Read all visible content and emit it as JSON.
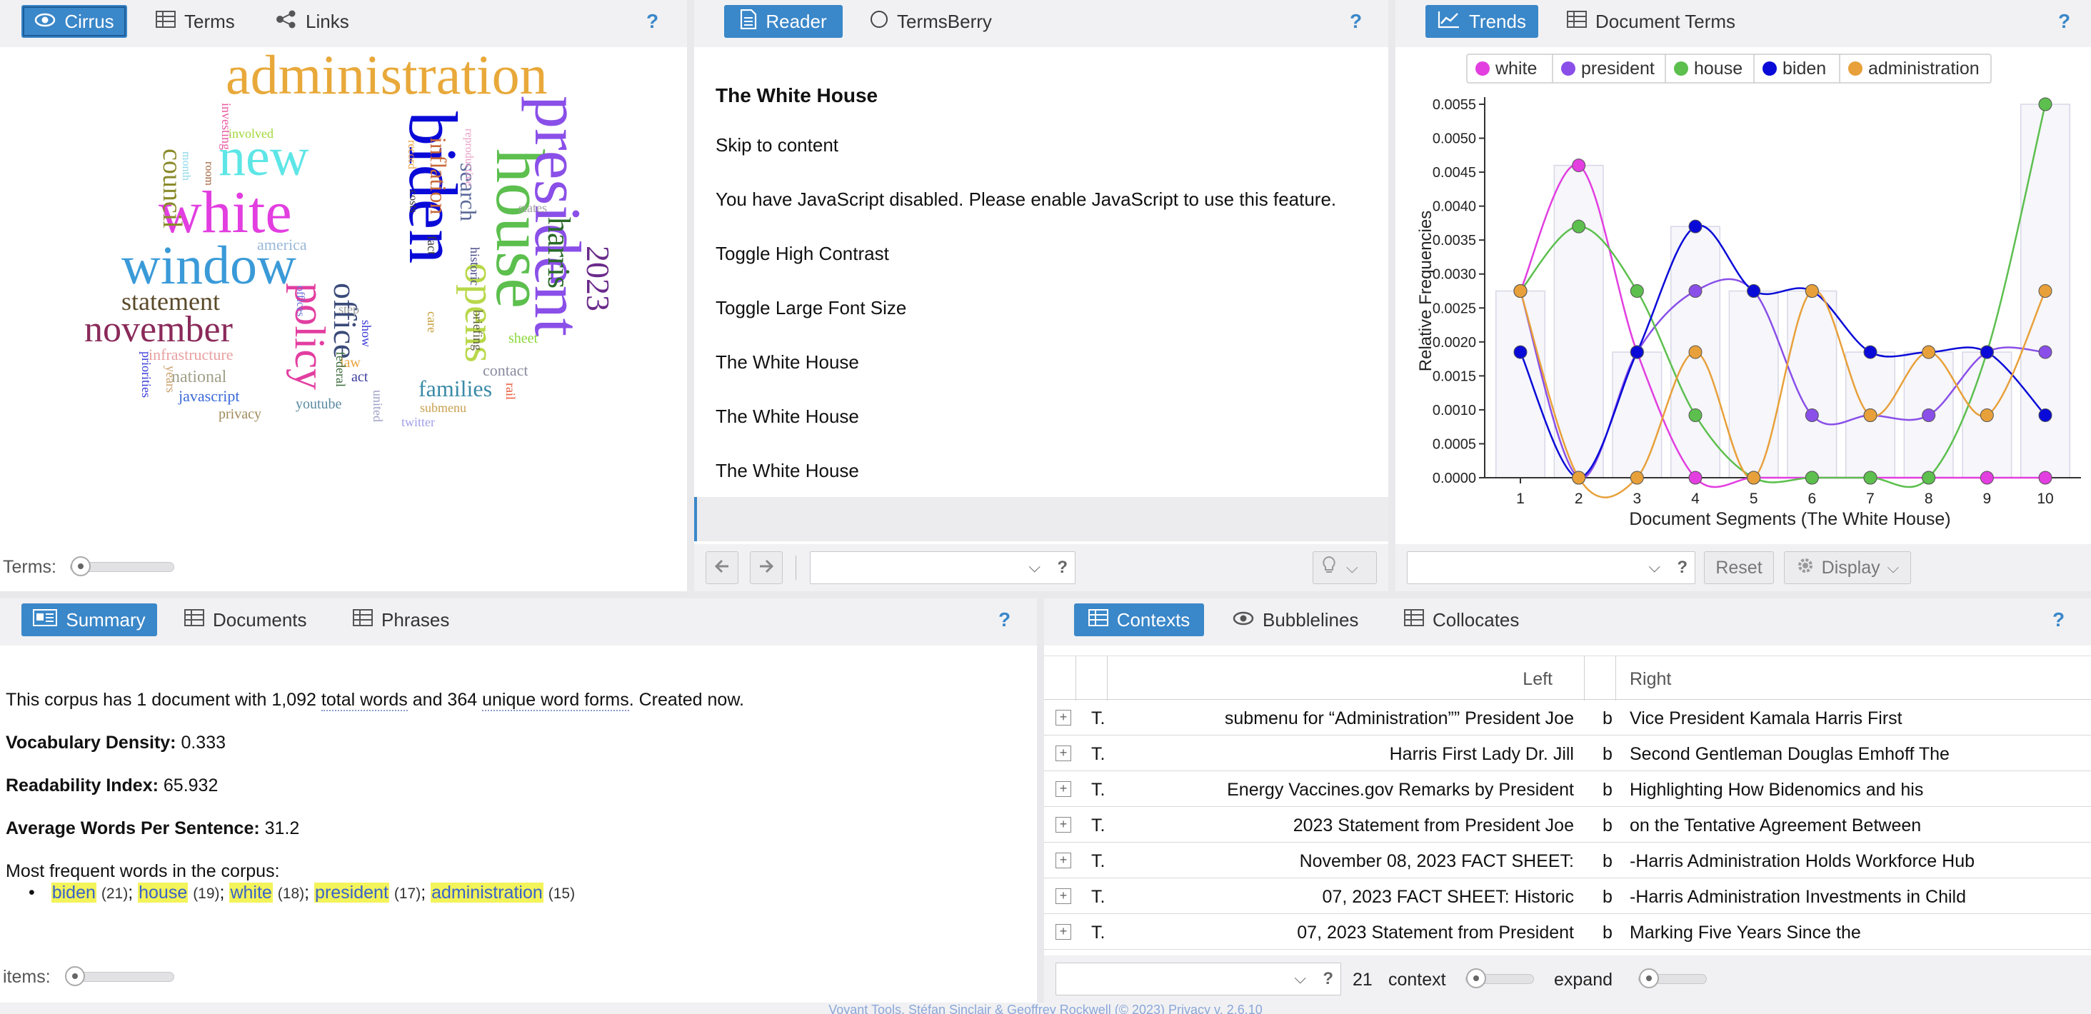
{
  "cirrus_panel": {
    "tabs": [
      {
        "label": "Cirrus",
        "icon": "eye-icon"
      },
      {
        "label": "Terms",
        "icon": "table-icon"
      },
      {
        "label": "Links",
        "icon": "network-icon"
      }
    ],
    "help": "?",
    "terms_label": "Terms:",
    "words": [
      {
        "text": "administration",
        "color": "#e8a93a"
      },
      {
        "text": "biden",
        "color": "#0a0ad8"
      },
      {
        "text": "house",
        "color": "#5cbf4e"
      },
      {
        "text": "president",
        "color": "#8a4fe8"
      },
      {
        "text": "white",
        "color": "#e23ee0"
      },
      {
        "text": "window",
        "color": "#3a9ad8"
      },
      {
        "text": "new",
        "color": "#5ee6e6"
      },
      {
        "text": "opens",
        "color": "#b8d84a"
      },
      {
        "text": "november",
        "color": "#8a2a5a"
      },
      {
        "text": "policy",
        "color": "#e23ea0"
      },
      {
        "text": "office",
        "color": "#3a4a7a"
      },
      {
        "text": "harris",
        "color": "#2a6a2a"
      },
      {
        "text": "2023",
        "color": "#6a2a8a"
      },
      {
        "text": "council",
        "color": "#8a8a2a"
      },
      {
        "text": "statement",
        "color": "#5a4a2a"
      },
      {
        "text": "families",
        "color": "#3a8aa8"
      },
      {
        "text": "search",
        "color": "#5a6a9a"
      },
      {
        "text": "inflation",
        "color": "#c86a3a"
      },
      {
        "text": "america",
        "color": "#9ab8d8"
      },
      {
        "text": "infrastructure",
        "color": "#e8a0a0"
      },
      {
        "text": "national",
        "color": "#a0a08a"
      },
      {
        "text": "javascript",
        "color": "#3a6ad8"
      },
      {
        "text": "privacy",
        "color": "#a08a5a"
      },
      {
        "text": "youtube",
        "color": "#5a8aa0"
      },
      {
        "text": "contact",
        "color": "#8a8aa0"
      },
      {
        "text": "twitter",
        "color": "#a0a0e8"
      },
      {
        "text": "submenu",
        "color": "#c8a050"
      },
      {
        "text": "rail",
        "color": "#e85a3a"
      },
      {
        "text": "act",
        "color": "#3a3aa0"
      },
      {
        "text": "law",
        "color": "#e8a03a"
      },
      {
        "text": "federal",
        "color": "#3a6a3a"
      },
      {
        "text": "united",
        "color": "#a0a0c8"
      },
      {
        "text": "show",
        "color": "#3a3ad8"
      },
      {
        "text": "step",
        "color": "#a0a0a0"
      },
      {
        "text": "care",
        "color": "#c8a03a"
      },
      {
        "text": "briefing",
        "color": "#5a5a3a"
      },
      {
        "text": "historic",
        "color": "#4a4a8a"
      },
      {
        "text": "sheet",
        "color": "#8ad83a"
      },
      {
        "text": "states",
        "color": "#a0a0a0"
      },
      {
        "text": "fact",
        "color": "#3a3a3a"
      },
      {
        "text": "costs",
        "color": "#3a3a3a"
      },
      {
        "text": "record",
        "color": "#e8a03a"
      },
      {
        "text": "reproductive",
        "color": "#e8a0c8"
      },
      {
        "text": "involved",
        "color": "#a0d83a"
      },
      {
        "text": "investing",
        "color": "#e85aa0"
      },
      {
        "text": "room",
        "color": "#a0603a"
      },
      {
        "text": "month",
        "color": "#8ad8e8"
      },
      {
        "text": "offices",
        "color": "#6a6ad8"
      },
      {
        "text": "priorities",
        "color": "#3a3ad8"
      },
      {
        "text": "years",
        "color": "#c8a06a"
      }
    ]
  },
  "reader_panel": {
    "tabs": [
      {
        "label": "Reader",
        "icon": "document-icon"
      },
      {
        "label": "TermsBerry",
        "icon": "circle-icon"
      }
    ],
    "help": "?",
    "heading": "The White House",
    "lines": [
      "Skip to content",
      "You have JavaScript disabled. Please enable JavaScript to use this feature.",
      "Toggle High Contrast",
      "Toggle Large Font Size",
      "The White House",
      "The White House",
      "The White House"
    ]
  },
  "trends_panel": {
    "tabs": [
      {
        "label": "Trends",
        "icon": "line-chart-icon"
      },
      {
        "label": "Document Terms",
        "icon": "table-icon"
      }
    ],
    "help": "?",
    "reset_label": "Reset",
    "display_label": "Display"
  },
  "chart_data": {
    "type": "line",
    "xlabel": "Document Segments (The White House)",
    "ylabel": "Relative Frequencies",
    "x": [
      1,
      2,
      3,
      4,
      5,
      6,
      7,
      8,
      9,
      10
    ],
    "ylim": [
      0,
      0.0055
    ],
    "yticks": [
      "0.0000",
      "0.0005",
      "0.0010",
      "0.0015",
      "0.0020",
      "0.0025",
      "0.0030",
      "0.0035",
      "0.0040",
      "0.0045",
      "0.0050",
      "0.0055"
    ],
    "legend_position": "top",
    "series": [
      {
        "name": "white",
        "color": "#e23ee0",
        "values": [
          0.00275,
          0.0046,
          0.00185,
          0.0,
          0.0,
          0.0,
          0.0,
          0.0,
          0.0,
          0.0
        ]
      },
      {
        "name": "president",
        "color": "#8a4fe8",
        "values": [
          0.00275,
          0.0,
          0.00185,
          0.00275,
          0.00275,
          0.00092,
          0.00092,
          0.00092,
          0.00185,
          0.00185
        ]
      },
      {
        "name": "house",
        "color": "#5cbf4e",
        "values": [
          0.00275,
          0.0037,
          0.00275,
          0.00092,
          0.0,
          0.0,
          0.0,
          0.0,
          0.00185,
          0.0055
        ]
      },
      {
        "name": "biden",
        "color": "#0a0ad8",
        "values": [
          0.00185,
          0.0,
          0.00185,
          0.0037,
          0.00275,
          0.00275,
          0.00185,
          0.00185,
          0.00185,
          0.00092
        ]
      },
      {
        "name": "administration",
        "color": "#e8a03a",
        "values": [
          0.00275,
          0.0,
          0.0,
          0.00185,
          0.0,
          0.00275,
          0.00092,
          0.00185,
          0.00092,
          0.00275
        ]
      }
    ],
    "bar_values": [
      0.00275,
      0.0046,
      0.00185,
      0.0037,
      0.00275,
      0.00275,
      0.00185,
      0.00185,
      0.00185,
      0.0055
    ]
  },
  "summary_panel": {
    "tabs": [
      {
        "label": "Summary",
        "icon": "summary-icon"
      },
      {
        "label": "Documents",
        "icon": "table-icon"
      },
      {
        "label": "Phrases",
        "icon": "table-icon"
      }
    ],
    "help": "?",
    "intro_pre": "This corpus has 1 document with 1,092 ",
    "intro_total": "total words",
    "intro_mid": " and 364 ",
    "intro_unique": "unique word forms",
    "intro_post": ". Created now.",
    "density_label": "Vocabulary Density:",
    "density_value": " 0.333",
    "readability_label": "Readability Index:",
    "readability_value": " 65.932",
    "avgwords_label": "Average Words Per Sentence:",
    "avgwords_value": " 31.2",
    "frequent_label": "Most frequent words in the corpus:",
    "frequent": [
      {
        "word": "biden",
        "count": "(21)"
      },
      {
        "word": "house",
        "count": "(19)"
      },
      {
        "word": "white",
        "count": "(18)"
      },
      {
        "word": "president",
        "count": "(17)"
      },
      {
        "word": "administration",
        "count": "(15)"
      }
    ],
    "items_label": "items:"
  },
  "contexts_panel": {
    "tabs": [
      {
        "label": "Contexts",
        "icon": "table-icon"
      },
      {
        "label": "Bubblelines",
        "icon": "eye-icon"
      },
      {
        "label": "Collocates",
        "icon": "table-icon"
      }
    ],
    "help": "?",
    "header_left": "Left",
    "header_right": "Right",
    "rows": [
      {
        "doc": "T.",
        "left": "submenu for “Administration”” President Joe",
        "term": "b",
        "right": "Vice President Kamala Harris First"
      },
      {
        "doc": "T.",
        "left": "Harris First Lady Dr. Jill",
        "term": "b",
        "right": "Second Gentleman Douglas Emhoff The"
      },
      {
        "doc": "T.",
        "left": "Energy Vaccines.gov Remarks by President",
        "term": "b",
        "right": "Highlighting How Bidenomics and his"
      },
      {
        "doc": "T.",
        "left": "2023 Statement from President Joe",
        "term": "b",
        "right": "on the Tentative Agreement Between"
      },
      {
        "doc": "T.",
        "left": "November 08, 2023 FACT SHEET:",
        "term": "b",
        "right": "-Harris Administration Holds Workforce Hub"
      },
      {
        "doc": "T.",
        "left": "07, 2023 FACT SHEET: Historic",
        "term": "b",
        "right": "-Harris Administration Investments in Child"
      },
      {
        "doc": "T.",
        "left": "07, 2023 Statement from President",
        "term": "b",
        "right": "Marking Five Years Since the"
      }
    ],
    "context_count": "21",
    "context_label": "context",
    "expand_label": "expand"
  },
  "footer": {
    "text": "Voyant Tools, Stéfan Sinclair & Geoffrey Rockwell (© 2023) Privacy v. 2.6.10"
  }
}
